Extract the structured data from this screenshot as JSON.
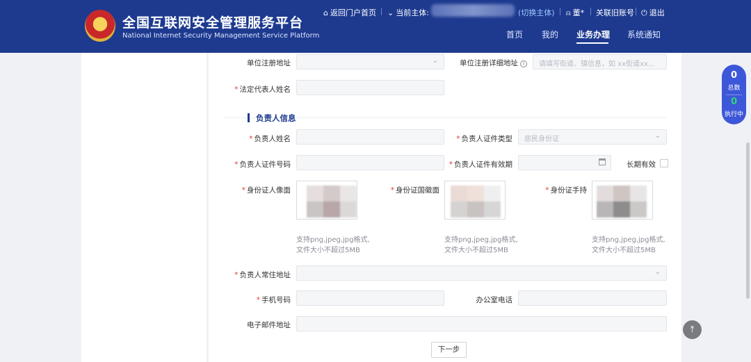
{
  "header": {
    "title_cn": "全国互联网安全管理服务平台",
    "title_en": "National Internet Security Management Service Platform",
    "back_portal": "返回门户首页",
    "current_subject_label": "当前主体:",
    "switch_subject": "(切换主体)",
    "user_name": "董*",
    "link_old_account": "关联旧账号",
    "logout": "退出",
    "nav": [
      "首页",
      "我的",
      "业务办理",
      "系统通知"
    ],
    "active_nav_index": 2
  },
  "form": {
    "reg_address_label": "单位注册地址",
    "reg_address_detail_label": "单位注册详细地址",
    "reg_address_detail_placeholder": "请填写街道、镇信息，如 xx街道xx...",
    "legal_rep_label": "法定代表人姓名",
    "section_title": "负责人信息",
    "person_name_label": "负责人姓名",
    "id_type_label": "负责人证件类型",
    "id_type_value": "居民身份证",
    "id_number_label": "负责人证件号码",
    "id_validity_label": "负责人证件有效期",
    "long_term_label": "长期有效",
    "id_front_label": "身份证人像面",
    "id_back_label": "身份证国徽面",
    "id_hand_label": "身份证手持",
    "upload_hint_line1": "支持png,jpeg,jpg格式,",
    "upload_hint_line2": "文件大小不超过5MB",
    "residence_label": "负责人常住地址",
    "phone_label": "手机号码",
    "office_phone_label": "办公室电话",
    "email_label": "电子邮件地址",
    "next_button": "下一步"
  },
  "stats": {
    "total_count": "0",
    "total_label": "总数",
    "running_count": "0",
    "running_label": "执行中"
  },
  "colors": {
    "header_bg": "#1d3a8f",
    "required": "#e23b3b",
    "widget_bg": "#3d57d9",
    "running_green": "#35d07f"
  }
}
